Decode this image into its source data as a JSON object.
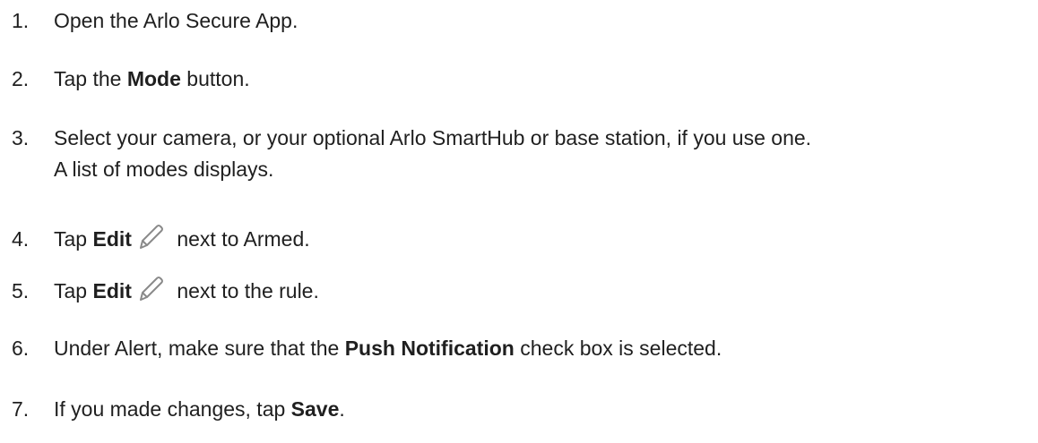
{
  "steps": [
    {
      "num": "1.",
      "pre": "Open the Arlo Secure App.",
      "bold": "",
      "post": ""
    },
    {
      "num": "2.",
      "pre": "Tap the ",
      "bold": "Mode",
      "post": " button."
    },
    {
      "num": "3.",
      "line1": "Select your camera, or your optional Arlo SmartHub or base station, if you use one.",
      "line2": "A list of modes displays."
    },
    {
      "num": "4.",
      "pre": "Tap ",
      "bold": "Edit",
      "post": " next to Armed.",
      "icon": "pencil-icon"
    },
    {
      "num": "5.",
      "pre": "Tap ",
      "bold": "Edit",
      "post": " next to the rule.",
      "icon": "pencil-icon"
    },
    {
      "num": "6.",
      "pre": "Under Alert, make sure that the ",
      "bold": "Push Notification",
      "post": " check box is selected."
    },
    {
      "num": "7.",
      "pre": "If you made changes, tap ",
      "bold": "Save",
      "post": "."
    }
  ],
  "colors": {
    "text": "#1f1f1f",
    "icon_stroke": "#8a8a8a"
  }
}
